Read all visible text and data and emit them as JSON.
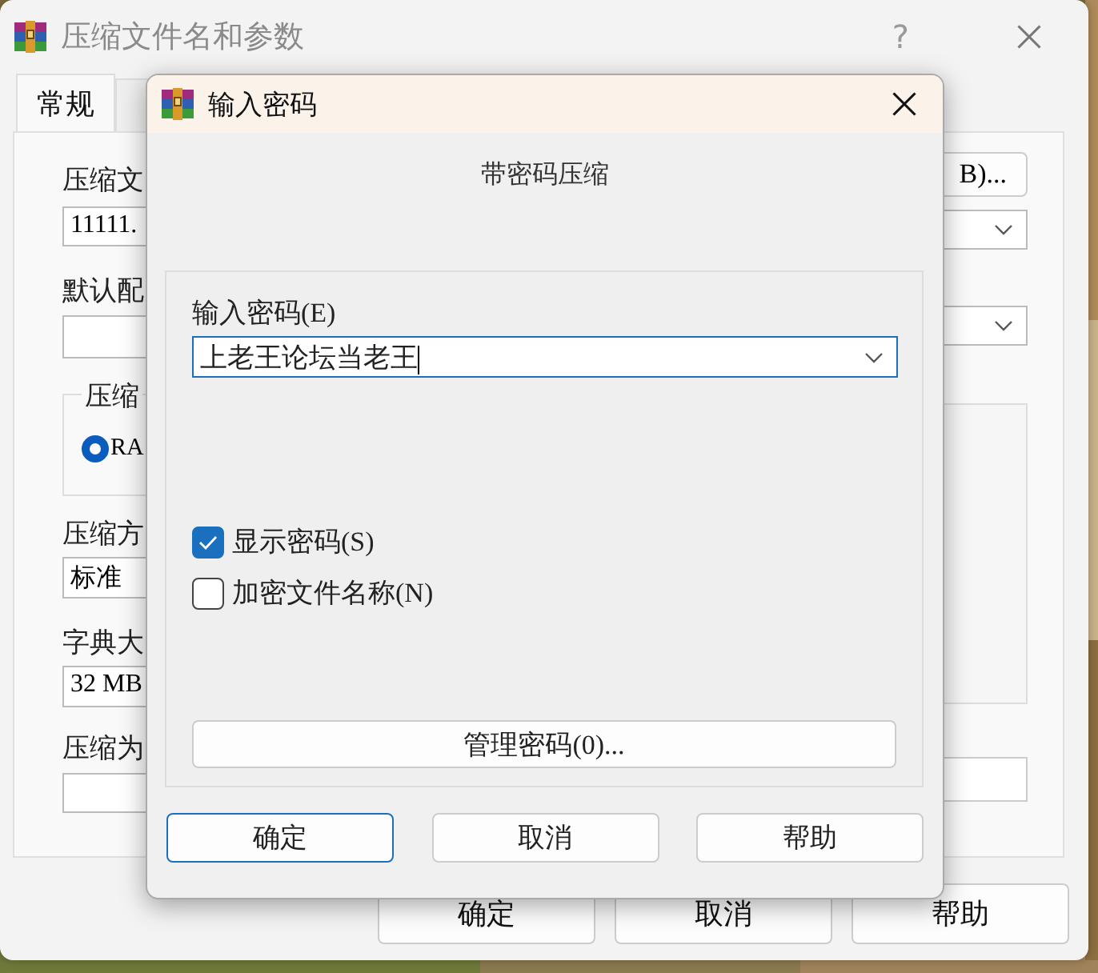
{
  "background_window": {
    "title": "压缩文件名和参数",
    "help": "?",
    "tabs": [
      {
        "label": "常规",
        "selected": true
      },
      {
        "selected": false
      }
    ],
    "archive_name": {
      "label": "压缩文",
      "value": "11111."
    },
    "profile": {
      "label": "默认配"
    },
    "format_group": {
      "legend": "压缩",
      "option": {
        "label": "RA",
        "selected": true
      }
    },
    "method": {
      "label": "压缩方",
      "value": "标准"
    },
    "dictionary": {
      "label": "字典大",
      "value": "32 MB"
    },
    "split": {
      "label": "压缩为"
    },
    "browse_button": "B)...",
    "buttons": [
      "确定",
      "取消",
      "帮助"
    ]
  },
  "dialog": {
    "title": "输入密码",
    "heading": "带密码压缩",
    "password": {
      "label": "输入密码(E)",
      "value": "上老王论坛当老王"
    },
    "options": [
      {
        "label": "显示密码(S)",
        "checked": true
      },
      {
        "label": "加密文件名称(N)",
        "checked": false
      }
    ],
    "manage_button": "管理密码(0)...",
    "buttons": [
      {
        "label": "确定",
        "default": true
      },
      {
        "label": "取消",
        "default": false
      },
      {
        "label": "帮助",
        "default": false
      }
    ]
  }
}
